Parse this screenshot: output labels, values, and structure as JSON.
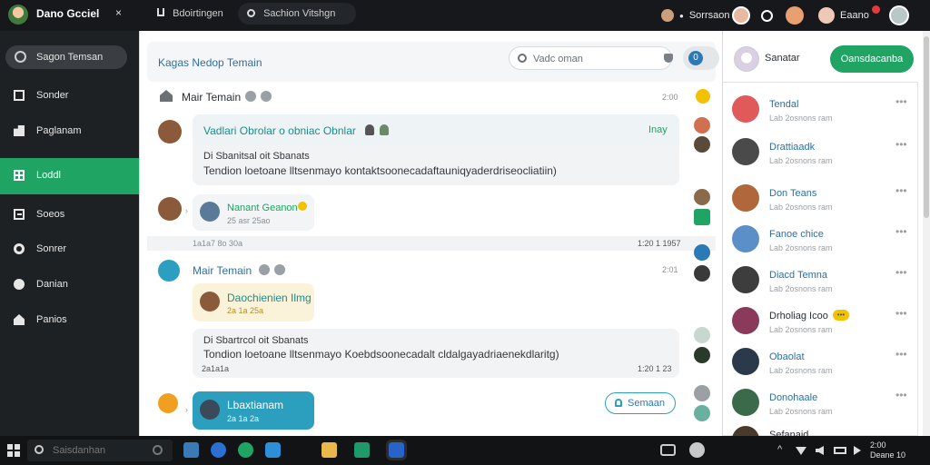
{
  "topbar": {
    "app_name": "Dano Gcciel",
    "close_glyph": "×",
    "tab_label": "Bdoirtingen",
    "search_text": "Sachion Vitshgn",
    "right_label_1": "Sorrsaon",
    "right_label_2": "Eaano"
  },
  "sidebar": {
    "search_label": "Sagon Temsan",
    "items": [
      {
        "label": "Sonder"
      },
      {
        "label": "Paglanam"
      },
      {
        "label": "Loddl"
      },
      {
        "label": "Soeos"
      },
      {
        "label": "Sonrer"
      },
      {
        "label": "Danian"
      },
      {
        "label": "Panios"
      }
    ]
  },
  "main": {
    "title": "Kagas Nedop Temain",
    "search_placeholder": "Vadc oman",
    "head_badge": "0",
    "thread1": {
      "sender": "Mair Temain",
      "time": "2:00",
      "quote_title": "Vadlari Obrolar o obniac Obnlar",
      "quote_tag": "Inay",
      "line1": "Di Sbanitsal oit Sbanats",
      "line2": "Tendion loetoane lltsenmayo kontaktsoonecadaftauniqyaderdriseocliatiin)",
      "reply_name": "Nanant Geanon",
      "reply_sub": "25 asr 25ao",
      "divider_left": "1a1a7 8o 30a",
      "divider_right": "1:20 1 1957"
    },
    "thread2": {
      "sender": "Mair Temain",
      "time": "2:01",
      "card_title": "Daochienien Ilmg",
      "card_sub": "2a 1a 25a",
      "line1": "Di Sbartrcol oit Sbanats",
      "line2": "Tondion loetoane lltsenmayo Koebdsoonecadalt cldalgayadriaenekdlaritg)",
      "date_left": "2a1a1a",
      "date_right": "1:20 1 23",
      "blue_title": "Lbaxtianam",
      "blue_sub": "2a 1a 2a",
      "action_button": "Semaan"
    }
  },
  "right_panel": {
    "header_label": "Sanatar",
    "button_label": "Oansdacanba",
    "contacts": [
      {
        "name": "Tendal",
        "sub": "Lab 2osnons ram",
        "color": "#e05a5a"
      },
      {
        "name": "Drattiaadk",
        "sub": "Lab 2osnons ram",
        "color": "#4a4a4a"
      },
      {
        "name": "Don Teans",
        "sub": "Lab 2osnons ram",
        "color": "#b0673a"
      },
      {
        "name": "Fanoe chice",
        "sub": "Lab 2osnons ram",
        "color": "#5a8fc7"
      },
      {
        "name": "Diacd Temna",
        "sub": "Lab 2osnons ram",
        "color": "#3d3d3d"
      },
      {
        "name": "Drholiag Icoo",
        "sub": "Lab 2osnons ram",
        "color": "#8a3a5a",
        "badge": "•••"
      },
      {
        "name": "Obaolat",
        "sub": "Lab 2osnons ram",
        "color": "#2b3a4a"
      },
      {
        "name": "Donohaale",
        "sub": "Lab 2osnons ram",
        "color": "#3a6a4a"
      },
      {
        "name": "Sefanaid",
        "sub": "",
        "color": "#4a3a2a"
      }
    ]
  },
  "taskbar": {
    "search_placeholder": "Saisdanhan",
    "time": "2:00",
    "date": "Deane 10"
  },
  "colors": {
    "accent_green": "#1fa463",
    "accent_blue": "#2c9fc1",
    "dark": "#1e2124"
  }
}
